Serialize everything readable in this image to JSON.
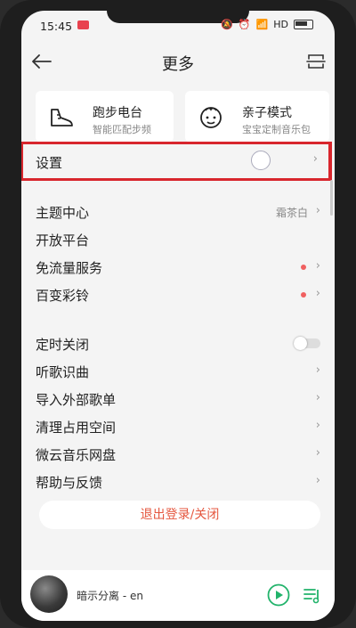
{
  "status": {
    "time": "15:45",
    "network": "HD"
  },
  "header": {
    "title": "更多"
  },
  "cards": [
    {
      "title": "跑步电台",
      "subtitle": "智能匹配步频",
      "icon": "running-shoe-icon"
    },
    {
      "title": "亲子模式",
      "subtitle": "宝宝定制音乐包",
      "icon": "baby-face-icon"
    }
  ],
  "settings": {
    "label": "设置"
  },
  "group1": [
    {
      "label": "主题中心",
      "value": "霜茶白"
    },
    {
      "label": "开放平台"
    },
    {
      "label": "免流量服务"
    },
    {
      "label": "百变彩铃"
    }
  ],
  "group2": [
    {
      "label": "定时关闭"
    },
    {
      "label": "听歌识曲"
    },
    {
      "label": "导入外部歌单"
    },
    {
      "label": "清理占用空间"
    },
    {
      "label": "微云音乐网盘"
    },
    {
      "label": "帮助与反馈"
    }
  ],
  "logout": {
    "label": "退出登录/关闭"
  },
  "player": {
    "song": "暗示分离 - en"
  },
  "colors": {
    "accent": "#22b36b",
    "highlight": "#d8262d",
    "dot": "#f06060"
  }
}
